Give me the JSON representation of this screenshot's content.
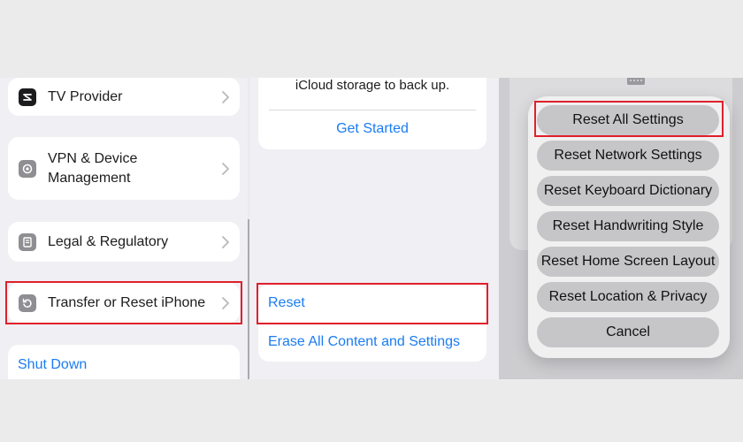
{
  "panel1": {
    "items": [
      {
        "label": "TV Provider"
      },
      {
        "label": "VPN & Device",
        "label2": "Management"
      },
      {
        "label": "Legal & Regulatory"
      },
      {
        "label": "Transfer or Reset iPhone"
      }
    ],
    "shutdown": "Shut Down"
  },
  "panel2": {
    "backup_text": "iCloud storage to back up.",
    "get_started": "Get Started",
    "reset": "Reset",
    "erase": "Erase All Content and Settings"
  },
  "panel3": {
    "options": [
      "Reset All Settings",
      "Reset Network Settings",
      "Reset Keyboard Dictionary",
      "Reset Handwriting Style",
      "Reset Home Screen Layout",
      "Reset Location & Privacy",
      "Cancel"
    ]
  },
  "colors": {
    "highlight": "#e0202a",
    "link": "#1a7cf2"
  }
}
